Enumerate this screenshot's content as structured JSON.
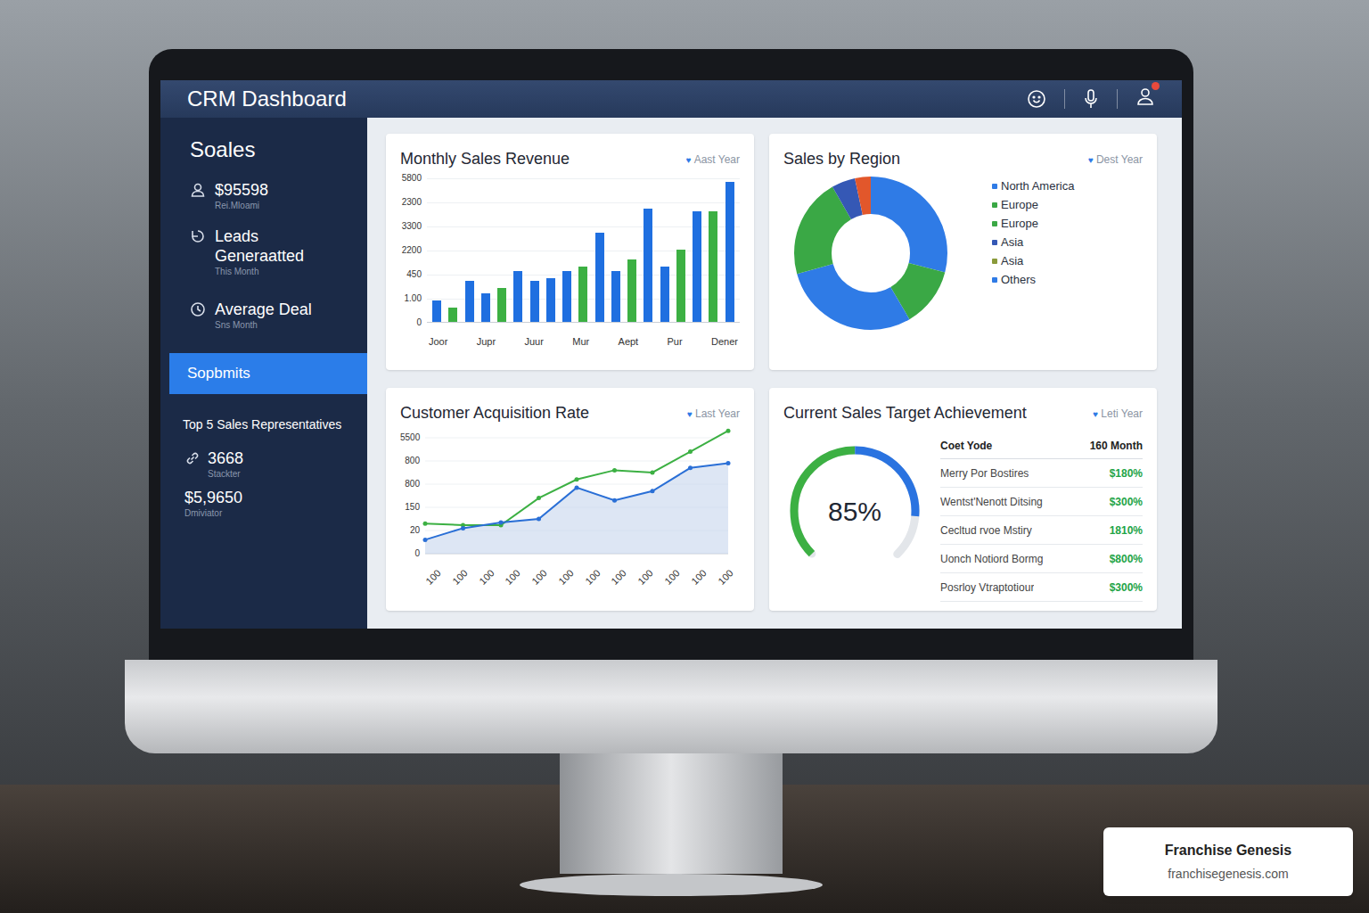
{
  "header": {
    "title": "CRM Dashboard",
    "notification_badge": true
  },
  "sidebar": {
    "title": "Soales",
    "stats": [
      {
        "value": "$95598",
        "sub": "Rei.Mloami"
      },
      {
        "value": "Leads Generaatted",
        "sub": "This Month"
      },
      {
        "value": "Average Deal",
        "sub": "Sns Month"
      }
    ],
    "nav": [
      {
        "label": "Sopbmits",
        "selected": true
      }
    ],
    "section_title": "Top 5 Sales Representatives",
    "reps": [
      {
        "value": "3668",
        "sub": "Stackter"
      },
      {
        "value": "$5,9650",
        "sub": "Dmiviator"
      }
    ]
  },
  "revenue": {
    "title": "Monthly Sales Revenue",
    "legend_icon": "♥",
    "legend": "Aast Year",
    "y_ticks": [
      "5800",
      "2300",
      "3300",
      "2200",
      "450",
      "1.00",
      "0"
    ],
    "x_labels": [
      "Joor",
      "Jupr",
      "Juur",
      "Mur",
      "Aept",
      "Pur",
      "Dener"
    ],
    "bars": [
      {
        "value": 0.9,
        "color": "#1f6fe0"
      },
      {
        "value": 0.6,
        "color": "#3cb043"
      },
      {
        "value": 1.7,
        "color": "#1f6fe0"
      },
      {
        "value": 1.2,
        "color": "#1f6fe0"
      },
      {
        "value": 1.4,
        "color": "#3cb043"
      },
      {
        "value": 2.1,
        "color": "#1f6fe0"
      },
      {
        "value": 1.7,
        "color": "#1f6fe0"
      },
      {
        "value": 1.8,
        "color": "#1f6fe0"
      },
      {
        "value": 2.1,
        "color": "#1f6fe0"
      },
      {
        "value": 2.3,
        "color": "#3cb043"
      },
      {
        "value": 3.7,
        "color": "#1f6fe0"
      },
      {
        "value": 2.1,
        "color": "#1f6fe0"
      },
      {
        "value": 2.6,
        "color": "#3cb043"
      },
      {
        "value": 4.7,
        "color": "#1f6fe0"
      },
      {
        "value": 2.3,
        "color": "#1f6fe0"
      },
      {
        "value": 3.0,
        "color": "#3cb043"
      },
      {
        "value": 4.6,
        "color": "#1f6fe0"
      },
      {
        "value": 4.6,
        "color": "#3cb043"
      },
      {
        "value": 5.8,
        "color": "#1f6fe0"
      }
    ]
  },
  "region": {
    "title": "Sales by Region",
    "legend_icon": "♥",
    "legend": "Dest Year",
    "segments": [
      {
        "value": 29,
        "color": "#2f7be6"
      },
      {
        "value": 12.5,
        "color": "#3aa845"
      },
      {
        "value": 29,
        "color": "#2f7be6"
      },
      {
        "value": 21,
        "color": "#3aa845"
      },
      {
        "value": 5,
        "color": "#3558b5"
      },
      {
        "value": 3.5,
        "color": "#e2572b"
      }
    ],
    "legend_items": [
      {
        "label": "North America",
        "color": "#2f7be6"
      },
      {
        "label": "Europe",
        "color": "#3aa845"
      },
      {
        "label": "Europe",
        "color": "#3aa845"
      },
      {
        "label": "Asia",
        "color": "#3558b5"
      },
      {
        "label": "Asia",
        "color": "#8a9a3a"
      },
      {
        "label": "Others",
        "color": "#2f7be6"
      }
    ]
  },
  "acquisition": {
    "title": "Customer Acquisition Rate",
    "legend_icon": "♥",
    "legend": "Last Year",
    "y_ticks": [
      "5500",
      "800",
      "800",
      "150",
      "20",
      "0"
    ],
    "x_labels": [
      "100",
      "100",
      "100",
      "100",
      "100",
      "100",
      "100",
      "100",
      "100",
      "100",
      "100",
      "100"
    ],
    "series": [
      {
        "color": "#3cb043",
        "values": [
          1.3,
          1.23,
          1.23,
          2.4,
          3.2,
          3.6,
          3.5,
          4.4,
          5.3
        ]
      },
      {
        "color": "#2a6fd6",
        "values": [
          0.6,
          1.1,
          1.35,
          1.5,
          2.85,
          2.3,
          2.7,
          3.7,
          3.9
        ]
      }
    ]
  },
  "target": {
    "title": "Current Sales Target Achievement",
    "legend_icon": "♥",
    "legend": "Leti Year",
    "level": 0.85,
    "reading": "85%",
    "columns": [
      "Coet Yode",
      "160 Month"
    ],
    "rows": [
      [
        "Merry Por Bostires",
        "$180%"
      ],
      [
        "Wentst'Nenott Ditsing",
        "$300%"
      ],
      [
        "Cecltud rvoe Mstiry",
        "1810%"
      ],
      [
        "Uonch Notiord Bormg",
        "$800%"
      ],
      [
        "Posrloy Vtraptotiour",
        "$300%"
      ]
    ]
  },
  "watermark": {
    "name": "Franchise Genesis",
    "url": "franchisegenesis.com"
  }
}
